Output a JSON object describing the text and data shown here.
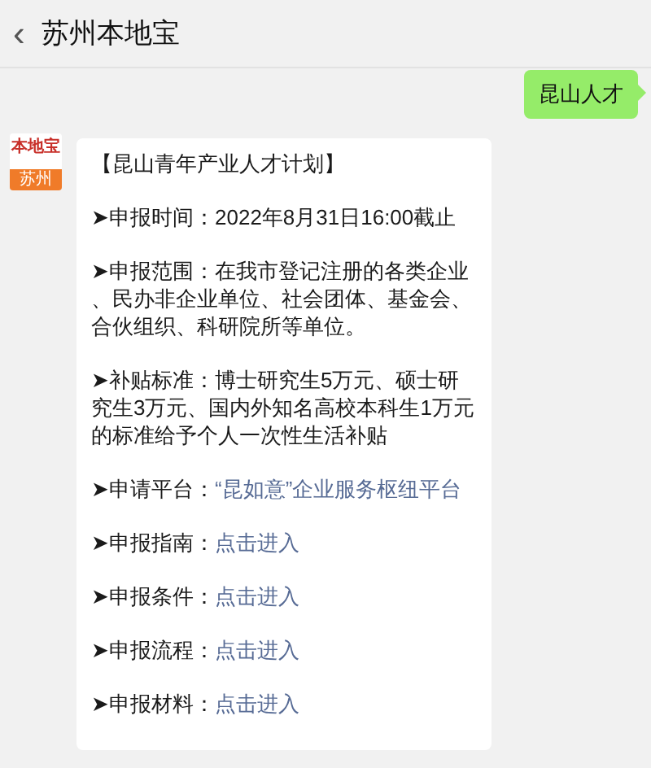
{
  "header": {
    "back_icon": "‹",
    "title": "苏州本地宝"
  },
  "messages": [
    {
      "kind": "outgoing",
      "text": "昆山人才"
    },
    {
      "kind": "incoming",
      "avatar": {
        "logo": "本地宝",
        "city": "苏州"
      },
      "title": "【昆山青年产业人才计划】",
      "items": [
        {
          "label": "➤申报时间：",
          "value": "2022年8月31日16:00截止",
          "link": false
        },
        {
          "label": "➤申报范围：",
          "value": "在我市登记注册的各类企业、民办非企业单位、社会团体、基金会、合伙组织、科研院所等单位。",
          "link": false
        },
        {
          "label": "➤补贴标准：",
          "value": "博士研究生5万元、硕士研究生3万元、国内外知名高校本科生1万元的标准给予个人一次性生活补贴",
          "link": false
        },
        {
          "label": "➤申请平台：",
          "value": "“昆如意”企业服务枢纽平台",
          "link": true
        },
        {
          "label": "➤申报指南：",
          "value": "点击进入",
          "link": true
        },
        {
          "label": "➤申报条件：",
          "value": "点击进入",
          "link": true
        },
        {
          "label": "➤申报流程：",
          "value": "点击进入",
          "link": true
        },
        {
          "label": "➤申报材料：",
          "value": "点击进入",
          "link": true
        }
      ]
    }
  ]
}
